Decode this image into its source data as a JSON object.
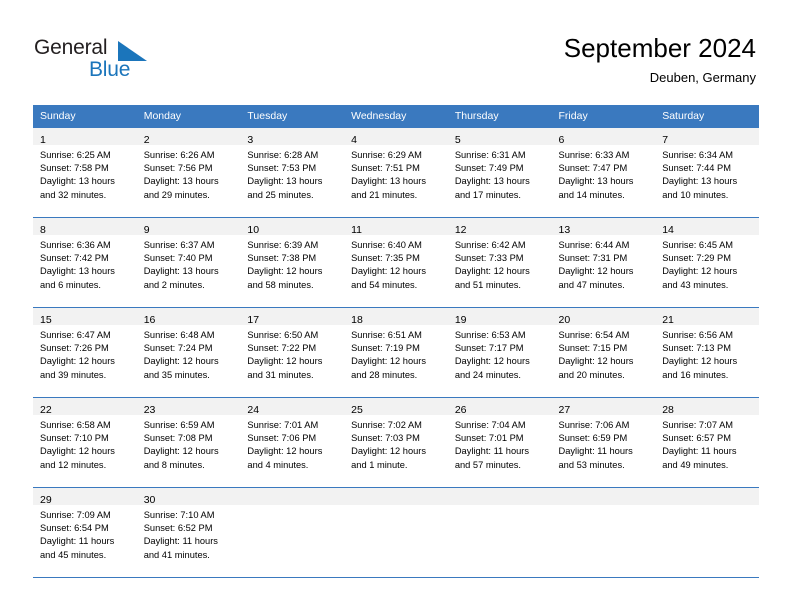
{
  "brand": {
    "name_part1": "General",
    "name_part2": "Blue",
    "triangle_color": "#1b75bb"
  },
  "header": {
    "title": "September 2024",
    "location": "Deuben, Germany"
  },
  "theme": {
    "header_blue": "#3a79bf",
    "daynum_band": "#f2f2f2",
    "text": "#000000"
  },
  "weekdays": [
    "Sunday",
    "Monday",
    "Tuesday",
    "Wednesday",
    "Thursday",
    "Friday",
    "Saturday"
  ],
  "weeks": [
    [
      {
        "day": "1",
        "sunrise": "Sunrise: 6:25 AM",
        "sunset": "Sunset: 7:58 PM",
        "daylight1": "Daylight: 13 hours",
        "daylight2": "and 32 minutes."
      },
      {
        "day": "2",
        "sunrise": "Sunrise: 6:26 AM",
        "sunset": "Sunset: 7:56 PM",
        "daylight1": "Daylight: 13 hours",
        "daylight2": "and 29 minutes."
      },
      {
        "day": "3",
        "sunrise": "Sunrise: 6:28 AM",
        "sunset": "Sunset: 7:53 PM",
        "daylight1": "Daylight: 13 hours",
        "daylight2": "and 25 minutes."
      },
      {
        "day": "4",
        "sunrise": "Sunrise: 6:29 AM",
        "sunset": "Sunset: 7:51 PM",
        "daylight1": "Daylight: 13 hours",
        "daylight2": "and 21 minutes."
      },
      {
        "day": "5",
        "sunrise": "Sunrise: 6:31 AM",
        "sunset": "Sunset: 7:49 PM",
        "daylight1": "Daylight: 13 hours",
        "daylight2": "and 17 minutes."
      },
      {
        "day": "6",
        "sunrise": "Sunrise: 6:33 AM",
        "sunset": "Sunset: 7:47 PM",
        "daylight1": "Daylight: 13 hours",
        "daylight2": "and 14 minutes."
      },
      {
        "day": "7",
        "sunrise": "Sunrise: 6:34 AM",
        "sunset": "Sunset: 7:44 PM",
        "daylight1": "Daylight: 13 hours",
        "daylight2": "and 10 minutes."
      }
    ],
    [
      {
        "day": "8",
        "sunrise": "Sunrise: 6:36 AM",
        "sunset": "Sunset: 7:42 PM",
        "daylight1": "Daylight: 13 hours",
        "daylight2": "and 6 minutes."
      },
      {
        "day": "9",
        "sunrise": "Sunrise: 6:37 AM",
        "sunset": "Sunset: 7:40 PM",
        "daylight1": "Daylight: 13 hours",
        "daylight2": "and 2 minutes."
      },
      {
        "day": "10",
        "sunrise": "Sunrise: 6:39 AM",
        "sunset": "Sunset: 7:38 PM",
        "daylight1": "Daylight: 12 hours",
        "daylight2": "and 58 minutes."
      },
      {
        "day": "11",
        "sunrise": "Sunrise: 6:40 AM",
        "sunset": "Sunset: 7:35 PM",
        "daylight1": "Daylight: 12 hours",
        "daylight2": "and 54 minutes."
      },
      {
        "day": "12",
        "sunrise": "Sunrise: 6:42 AM",
        "sunset": "Sunset: 7:33 PM",
        "daylight1": "Daylight: 12 hours",
        "daylight2": "and 51 minutes."
      },
      {
        "day": "13",
        "sunrise": "Sunrise: 6:44 AM",
        "sunset": "Sunset: 7:31 PM",
        "daylight1": "Daylight: 12 hours",
        "daylight2": "and 47 minutes."
      },
      {
        "day": "14",
        "sunrise": "Sunrise: 6:45 AM",
        "sunset": "Sunset: 7:29 PM",
        "daylight1": "Daylight: 12 hours",
        "daylight2": "and 43 minutes."
      }
    ],
    [
      {
        "day": "15",
        "sunrise": "Sunrise: 6:47 AM",
        "sunset": "Sunset: 7:26 PM",
        "daylight1": "Daylight: 12 hours",
        "daylight2": "and 39 minutes."
      },
      {
        "day": "16",
        "sunrise": "Sunrise: 6:48 AM",
        "sunset": "Sunset: 7:24 PM",
        "daylight1": "Daylight: 12 hours",
        "daylight2": "and 35 minutes."
      },
      {
        "day": "17",
        "sunrise": "Sunrise: 6:50 AM",
        "sunset": "Sunset: 7:22 PM",
        "daylight1": "Daylight: 12 hours",
        "daylight2": "and 31 minutes."
      },
      {
        "day": "18",
        "sunrise": "Sunrise: 6:51 AM",
        "sunset": "Sunset: 7:19 PM",
        "daylight1": "Daylight: 12 hours",
        "daylight2": "and 28 minutes."
      },
      {
        "day": "19",
        "sunrise": "Sunrise: 6:53 AM",
        "sunset": "Sunset: 7:17 PM",
        "daylight1": "Daylight: 12 hours",
        "daylight2": "and 24 minutes."
      },
      {
        "day": "20",
        "sunrise": "Sunrise: 6:54 AM",
        "sunset": "Sunset: 7:15 PM",
        "daylight1": "Daylight: 12 hours",
        "daylight2": "and 20 minutes."
      },
      {
        "day": "21",
        "sunrise": "Sunrise: 6:56 AM",
        "sunset": "Sunset: 7:13 PM",
        "daylight1": "Daylight: 12 hours",
        "daylight2": "and 16 minutes."
      }
    ],
    [
      {
        "day": "22",
        "sunrise": "Sunrise: 6:58 AM",
        "sunset": "Sunset: 7:10 PM",
        "daylight1": "Daylight: 12 hours",
        "daylight2": "and 12 minutes."
      },
      {
        "day": "23",
        "sunrise": "Sunrise: 6:59 AM",
        "sunset": "Sunset: 7:08 PM",
        "daylight1": "Daylight: 12 hours",
        "daylight2": "and 8 minutes."
      },
      {
        "day": "24",
        "sunrise": "Sunrise: 7:01 AM",
        "sunset": "Sunset: 7:06 PM",
        "daylight1": "Daylight: 12 hours",
        "daylight2": "and 4 minutes."
      },
      {
        "day": "25",
        "sunrise": "Sunrise: 7:02 AM",
        "sunset": "Sunset: 7:03 PM",
        "daylight1": "Daylight: 12 hours",
        "daylight2": "and 1 minute."
      },
      {
        "day": "26",
        "sunrise": "Sunrise: 7:04 AM",
        "sunset": "Sunset: 7:01 PM",
        "daylight1": "Daylight: 11 hours",
        "daylight2": "and 57 minutes."
      },
      {
        "day": "27",
        "sunrise": "Sunrise: 7:06 AM",
        "sunset": "Sunset: 6:59 PM",
        "daylight1": "Daylight: 11 hours",
        "daylight2": "and 53 minutes."
      },
      {
        "day": "28",
        "sunrise": "Sunrise: 7:07 AM",
        "sunset": "Sunset: 6:57 PM",
        "daylight1": "Daylight: 11 hours",
        "daylight2": "and 49 minutes."
      }
    ],
    [
      {
        "day": "29",
        "sunrise": "Sunrise: 7:09 AM",
        "sunset": "Sunset: 6:54 PM",
        "daylight1": "Daylight: 11 hours",
        "daylight2": "and 45 minutes."
      },
      {
        "day": "30",
        "sunrise": "Sunrise: 7:10 AM",
        "sunset": "Sunset: 6:52 PM",
        "daylight1": "Daylight: 11 hours",
        "daylight2": "and 41 minutes."
      },
      {
        "day": "",
        "sunrise": "",
        "sunset": "",
        "daylight1": "",
        "daylight2": ""
      },
      {
        "day": "",
        "sunrise": "",
        "sunset": "",
        "daylight1": "",
        "daylight2": ""
      },
      {
        "day": "",
        "sunrise": "",
        "sunset": "",
        "daylight1": "",
        "daylight2": ""
      },
      {
        "day": "",
        "sunrise": "",
        "sunset": "",
        "daylight1": "",
        "daylight2": ""
      },
      {
        "day": "",
        "sunrise": "",
        "sunset": "",
        "daylight1": "",
        "daylight2": ""
      }
    ]
  ]
}
